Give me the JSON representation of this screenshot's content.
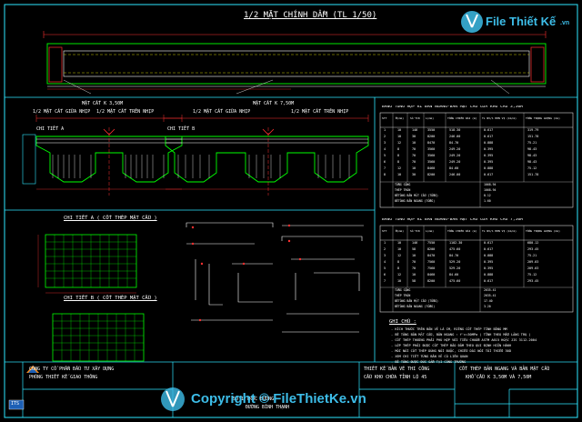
{
  "title_main": "1/2 MẶT CHÍNH DẦM (TL 1/50)",
  "sections": {
    "left": {
      "title": "MẶT CẮT K 3,50M",
      "sub_left": "1/2 MẶT CẮT GIỮA NHỊP",
      "sub_right": "1/2 MẶT CẮT TRÊN NHỊP",
      "detail": "CHI TIẾT A"
    },
    "right": {
      "title": "MẶT CẮT K 7,50M",
      "sub_left": "1/2 MẶT CẮT GIỮA NHỊP",
      "sub_right": "1/2 MẶT CẮT TRÊN NHỊP",
      "detail": "CHI TIẾT B"
    }
  },
  "details": {
    "a_title": "CHI TIẾT A ( CỐT THÉP MẶT CẦU )",
    "b_title": "CHI TIẾT B ( CỐT THÉP MẶT CẦU )"
  },
  "table1": {
    "title": "BẢNG TỔNG HỢP KL BẢN NGANG-BẢN MẶT CẦU CỬA KHỔ CẦU 3,50M",
    "headers": [
      "STT",
      "Φ(mm)",
      "Số TCK",
      "L(mm)",
      "TỔNG CHIỀU DÀI (m)",
      "TL NV/1 ĐƠN VỊ (kG/m)",
      "TỔNG TRỌNG LƯỢNG (kG)"
    ],
    "rows": [
      [
        "1",
        "10",
        "146",
        "3550",
        "518.30",
        "0.617",
        "319.79"
      ],
      [
        "2",
        "10",
        "30",
        "8200",
        "246.00",
        "0.617",
        "151.78"
      ],
      [
        "3",
        "12",
        "10",
        "8470",
        "84.70",
        "0.888",
        "75.21"
      ],
      [
        "4",
        "8",
        "70",
        "3560",
        "249.20",
        "0.395",
        "98.43"
      ],
      [
        "5",
        "8",
        "70",
        "3560",
        "249.20",
        "0.395",
        "98.43"
      ],
      [
        "6",
        "8",
        "70",
        "3560",
        "249.20",
        "0.395",
        "98.43"
      ],
      [
        "7",
        "12",
        "10",
        "8460",
        "84.60",
        "0.888",
        "75.12"
      ],
      [
        "8",
        "10",
        "30",
        "8200",
        "246.00",
        "0.617",
        "151.78"
      ]
    ],
    "totals": [
      [
        "TỔNG CỘNG",
        "1068.94"
      ],
      [
        "THÉP TRÒN",
        "1068.94"
      ],
      [
        "BÊTÔNG BẢN MẶT CẦU (TỔNG)",
        "8.12"
      ],
      [
        "BÊTÔNG BẢN NGANG (TỔNG)",
        "1.60"
      ]
    ]
  },
  "table2": {
    "title": "BẢNG TỔNG HỢP KL BẢN NGANG-BẢN MẶT CẦU CỬA KHỔ CẦU 7,50M",
    "headers": [
      "STT",
      "Φ(mm)",
      "Số TCK",
      "L(mm)",
      "TỔNG CHIỀU DÀI (m)",
      "TL NV/1 ĐƠN VỊ (kG/m)",
      "TỔNG TRỌNG LƯỢNG (kG)"
    ],
    "rows": [
      [
        "1",
        "10",
        "146",
        "7550",
        "1102.30",
        "0.617",
        "680.12"
      ],
      [
        "2",
        "10",
        "58",
        "8200",
        "475.60",
        "0.617",
        "293.45"
      ],
      [
        "3",
        "12",
        "10",
        "8470",
        "84.70",
        "0.888",
        "75.21"
      ],
      [
        "4",
        "8",
        "70",
        "7560",
        "529.20",
        "0.395",
        "209.03"
      ],
      [
        "5",
        "8",
        "70",
        "7560",
        "529.20",
        "0.395",
        "209.03"
      ],
      [
        "6",
        "12",
        "10",
        "8460",
        "84.60",
        "0.888",
        "75.12"
      ],
      [
        "7",
        "10",
        "58",
        "8200",
        "475.60",
        "0.617",
        "293.45"
      ]
    ],
    "totals": [
      [
        "TỔNG CỘNG",
        "2035.41"
      ],
      [
        "THÉP TRÒN",
        "2035.41"
      ],
      [
        "BÊTÔNG BẢN MẶT CẦU (TỔNG)",
        "17.40"
      ],
      [
        "BÊTÔNG BẢN NGANG (TỔNG)",
        "3.20"
      ]
    ]
  },
  "notes": {
    "title": "GHI CHÚ :",
    "items": [
      "- KÍCH THƯỚC TRÊN BẢN VẼ LÀ CM, RIÊNG CỐT THÉP TÍNH BẰNG MM",
      "- BÊ TÔNG BẢN MẶT CẦU, BẢN NGANG : f'c=30MPa ( TỈNH THEO MẪU LĂNG TRỤ )",
      "- CỐT THÉP THƯỜNG PHẢI PHÙ HỢP VỚI TIÊU CHUẨN ASTM A615 HOẶC JIS 3112-2004",
      "- LỚP THÉP PHẢI ĐƯỢC CỐT THÉP BẢO ĐẢM THEO QUI ĐỊNH HIỆN HÀNH",
      "- MỐI NỐI CỐT THÉP DÙNG NỐI BUỘC, CHIỀU DÀI NỐI TỐI THIỂU 30D",
      "- XEM CHI TIẾT TỪNG BẢN VẼ CÓ LIÊN QUAN",
      "- BÊ TÔNG ĐƯỢC ĐÚC SẴN TẠI CÔNG TRƯỜNG"
    ]
  },
  "title_block": {
    "company": "CÔNG TY CỔ PHẦN ĐẦU TƯ XÂY DỰNG",
    "company2": "PHÒNG THIẾT KẾ GIAO THÔNG",
    "project": "THIẾT KẾ BẢN VẼ THI CÔNG",
    "project2": "CẦU KHO CHỨA TỈNH LỘ 45",
    "drawing": "CỐT THÉP BẢN NGANG VÀ BẢN MẶT CẦU",
    "drawing2": "KHỔ CẦU K 3,50M VÀ 7,50M",
    "address": "ĐƯỜNG BÌNH THẠNH",
    "address2": "SỐ 1 TRỤC ĐƯỜNG",
    "logo_text": "ITS"
  },
  "watermark": {
    "top_brand": "File Thiết Kế",
    "top_domain": ".vn",
    "bottom": "Copyright © FileThietKe.vn"
  },
  "colors": {
    "background": "#000000",
    "frame": "#2ee6ff",
    "concrete": "#00ff00",
    "rebar": "#ffffff",
    "label": "#ff3030",
    "accent": "#ffff00",
    "watermark": "#3dbde8",
    "logo_orange": "#f08a1c"
  }
}
